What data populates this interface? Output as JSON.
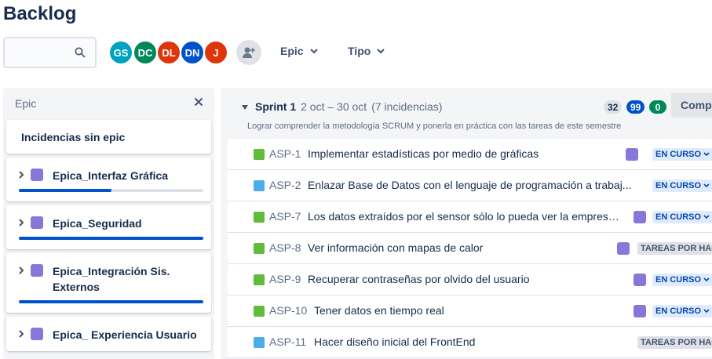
{
  "page_title": "Backlog",
  "search": {
    "placeholder": "",
    "icon": "search-icon"
  },
  "avatars": [
    {
      "initials": "GS",
      "color": "#00a3bf"
    },
    {
      "initials": "DC",
      "color": "#00875a"
    },
    {
      "initials": "DL",
      "color": "#de350b"
    },
    {
      "initials": "DN",
      "color": "#0052cc"
    },
    {
      "initials": "J",
      "color": "#de350b"
    }
  ],
  "filters": {
    "epic": "Epic",
    "type": "Tipo"
  },
  "epic_panel": {
    "header": "Epic",
    "no_epic": "Incidencias sin epic",
    "epics": [
      {
        "label": "Epica_Interfaz Gráfica",
        "progress": 0.5,
        "color": "#8777d9"
      },
      {
        "label": "Epica_Seguridad",
        "progress": 1.0,
        "color": "#8777d9"
      },
      {
        "label": "Epica_Integración Sis. Externos",
        "progress": 1.0,
        "color": "#8777d9"
      },
      {
        "label": "Epica_ Experiencia Usuario",
        "progress": null,
        "color": "#8777d9"
      }
    ]
  },
  "sprint": {
    "name": "Sprint 1",
    "dates": "2 oct – 30 oct",
    "count": "(7 incidencias)",
    "goal": "Lograr comprender la metodología SCRUM y ponerla en práctica con las tareas de este semestre",
    "points": {
      "todo": "32",
      "in_progress": "99",
      "done": "0"
    },
    "complete_label": "Completar sprint",
    "issues": [
      {
        "key": "ASP-1",
        "summary": "Implementar estadísticas por medio de gráficas",
        "type": "story",
        "status": "EN CURSO",
        "status_kind": "inprog"
      },
      {
        "key": "ASP-2",
        "summary": "Enlazar Base de Datos con el lenguaje de programación a trabaj...",
        "type": "task",
        "status": "EN CURSO",
        "status_kind": "inprog"
      },
      {
        "key": "ASP-7",
        "summary": "Los datos extraídos por el sensor sólo lo pueda ver la empresa q...",
        "type": "story",
        "status": "EN CURSO",
        "status_kind": "inprog"
      },
      {
        "key": "ASP-8",
        "summary": "Ver información con mapas de calor",
        "type": "story",
        "status": "TAREAS POR HAC",
        "status_kind": "todo"
      },
      {
        "key": "ASP-9",
        "summary": "Recuperar contraseñas por olvido del usuario",
        "type": "story",
        "status": "EN CURSO",
        "status_kind": "inprog"
      },
      {
        "key": "ASP-10",
        "summary": "Tener datos en tiempo real",
        "type": "story",
        "status": "EN CURSO",
        "status_kind": "inprog"
      },
      {
        "key": "ASP-11",
        "summary": "Hacer diseño inicial del FrontEnd",
        "type": "task",
        "status": "TAREAS POR HAC",
        "status_kind": "todo"
      }
    ]
  }
}
